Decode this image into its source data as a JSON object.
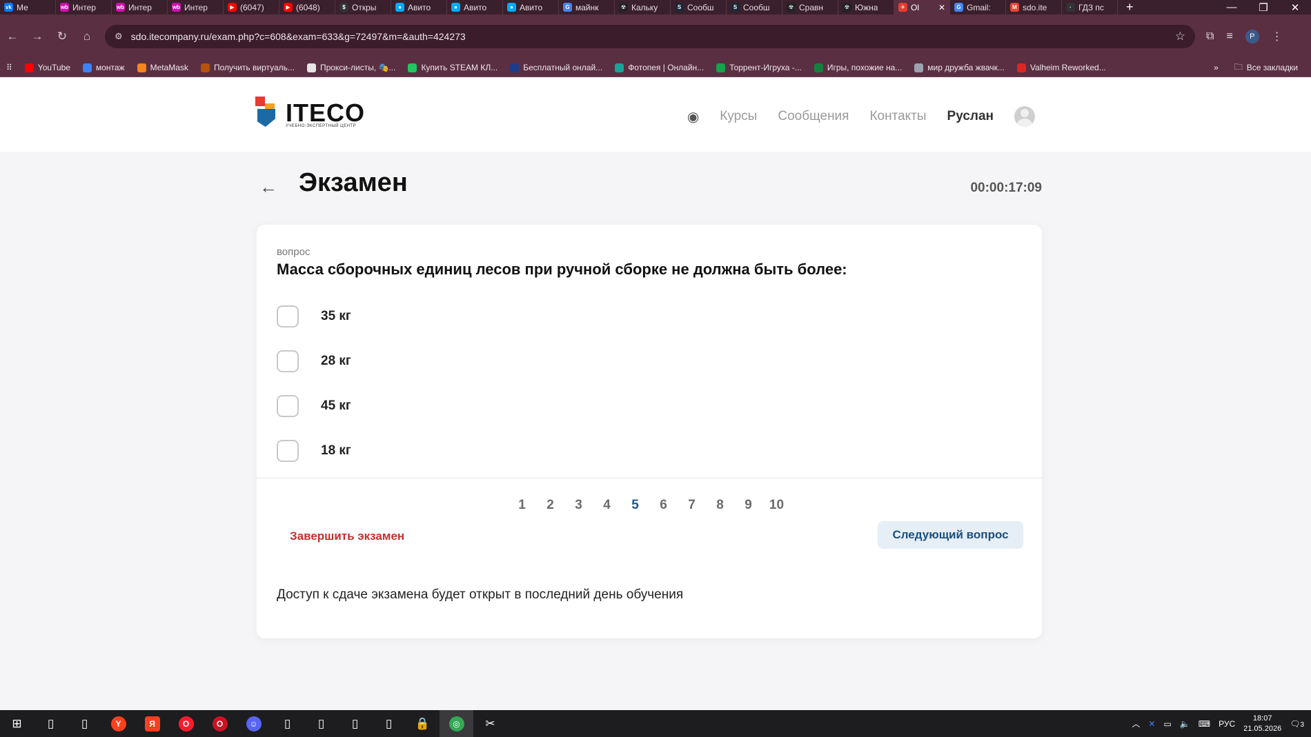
{
  "browser": {
    "tabs": [
      {
        "label": "Ме",
        "color": "#0077ff",
        "glyph": "vk"
      },
      {
        "label": "Интер",
        "color": "#cb11ab",
        "glyph": "wb"
      },
      {
        "label": "Интер",
        "color": "#cb11ab",
        "glyph": "wb"
      },
      {
        "label": "Интер",
        "color": "#cb11ab",
        "glyph": "wb"
      },
      {
        "label": "(6047)",
        "color": "#ff0000",
        "glyph": "▶"
      },
      {
        "label": "(6048)",
        "color": "#ff0000",
        "glyph": "▶"
      },
      {
        "label": "Откры",
        "color": "#333333",
        "glyph": "$"
      },
      {
        "label": "Авито",
        "color": "#00aaff",
        "glyph": "●"
      },
      {
        "label": "Авито",
        "color": "#00aaff",
        "glyph": "●"
      },
      {
        "label": "Авито",
        "color": "#00aaff",
        "glyph": "●"
      },
      {
        "label": "майнк",
        "color": "#4285f4",
        "glyph": "G"
      },
      {
        "label": "Кальку",
        "color": "#222222",
        "glyph": "☢"
      },
      {
        "label": "Сообш",
        "color": "#1b2838",
        "glyph": "S"
      },
      {
        "label": "Сообш",
        "color": "#1b2838",
        "glyph": "S"
      },
      {
        "label": "Сравн",
        "color": "#222222",
        "glyph": "☢"
      },
      {
        "label": "Южна",
        "color": "#222222",
        "glyph": "☢"
      },
      {
        "label": "Ol",
        "color": "#e63b2e",
        "glyph": "✈",
        "active": true
      },
      {
        "label": "Gmail:",
        "color": "#4285f4",
        "glyph": "G"
      },
      {
        "label": "sdo.ite",
        "color": "#ea4335",
        "glyph": "M"
      },
      {
        "label": "ГДЗ пс",
        "color": "#333333",
        "glyph": "·"
      }
    ],
    "url": "sdo.itecompany.ru/exam.php?c=608&exam=633&g=72497&m=&auth=424273",
    "profile_letter": "P",
    "bookmarks": [
      {
        "label": "YouTube",
        "color": "#ff0000"
      },
      {
        "label": "монтаж",
        "color": "#3b82f6"
      },
      {
        "label": "MetaMask",
        "color": "#f6851b"
      },
      {
        "label": "Получить виртуаль...",
        "color": "#b45309"
      },
      {
        "label": "Прокси-листы, 🎭...",
        "color": "#e5e5e5"
      },
      {
        "label": "Купить STEAM КЛ...",
        "color": "#22c55e"
      },
      {
        "label": "Бесплатный онлай...",
        "color": "#1e3a8a"
      },
      {
        "label": "Фотопея | Онлайн...",
        "color": "#18a497"
      },
      {
        "label": "Торрент-Игруха -...",
        "color": "#16a34a"
      },
      {
        "label": "Игры, похожие на...",
        "color": "#15803d"
      },
      {
        "label": "мир дружба жвачк...",
        "color": "#9ca3af"
      },
      {
        "label": "Valheim Reworked...",
        "color": "#dc2626"
      }
    ],
    "all_bookmarks": "Все закладки"
  },
  "header": {
    "logo_text": "ITECO",
    "logo_subtext": "УЧЕБНО-ЭКСПЕРТНЫЙ ЦЕНТР",
    "nav": [
      "Курсы",
      "Сообщения",
      "Контакты"
    ],
    "user": "Руслан"
  },
  "exam": {
    "title": "Экзамен",
    "timer": "00:00:17:09",
    "question_label": "вопрос",
    "question": "Масса сборочных единиц лесов при ручной сборке не должна быть более:",
    "options": [
      "35 кг",
      "28 кг",
      "45 кг",
      "18 кг"
    ],
    "pages": [
      "1",
      "2",
      "3",
      "4",
      "5",
      "6",
      "7",
      "8",
      "9",
      "10"
    ],
    "current_page": "5",
    "finish_label": "Завершить экзамен",
    "next_label": "Следующий вопрос",
    "access_note": "Доступ к сдаче экзамена будет открыт в последний день обучения"
  },
  "taskbar": {
    "language": "РУС",
    "time": "18:07",
    "date": "21.05.2026",
    "notifications": "3"
  }
}
